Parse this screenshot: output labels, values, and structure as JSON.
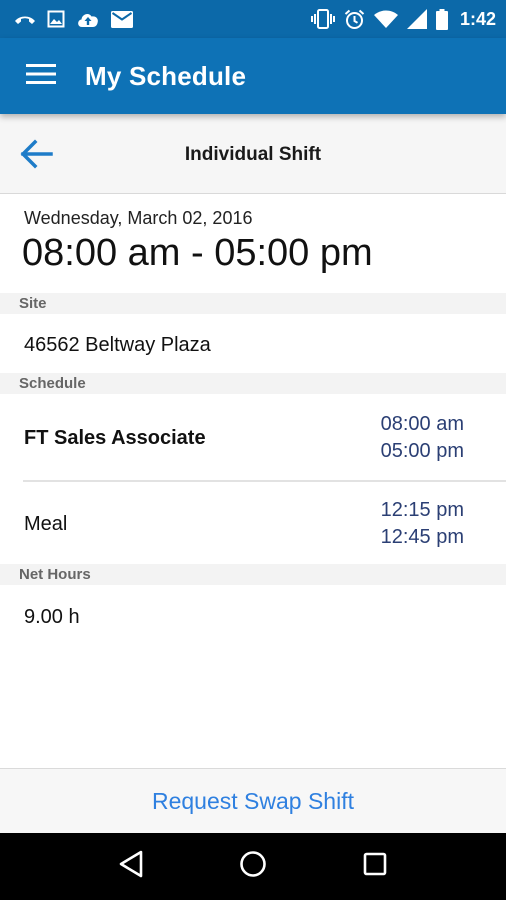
{
  "status_bar": {
    "time": "1:42",
    "left_icons": [
      "missed-call-icon",
      "image-icon",
      "cloud-upload-icon",
      "mail-icon"
    ],
    "right_icons": [
      "vibrate-icon",
      "alarm-icon",
      "wifi-icon",
      "signal-icon",
      "battery-icon"
    ]
  },
  "app_bar": {
    "title": "My Schedule",
    "menu_icon": "hamburger-menu-icon",
    "color": "#0e72b6"
  },
  "sub_header": {
    "title": "Individual Shift",
    "back_icon": "arrow-left-icon",
    "back_color": "#1e7cc8"
  },
  "shift": {
    "date": "Wednesday, March 02, 2016",
    "time_range": "08:00 am - 05:00 pm"
  },
  "site": {
    "header": "Site",
    "value": "46562 Beltway Plaza"
  },
  "schedule": {
    "header": "Schedule",
    "items": [
      {
        "label": "FT Sales Associate",
        "start": "08:00 am",
        "end": "05:00 pm"
      },
      {
        "label": "Meal",
        "start": "12:15 pm",
        "end": "12:45 pm"
      }
    ],
    "time_color": "#2b3f74"
  },
  "net_hours": {
    "header": "Net Hours",
    "value": "9.00 h"
  },
  "actions": {
    "swap_label": "Request Swap Shift",
    "swap_color": "#2f80e0"
  },
  "nav_bar": {
    "icons": [
      "nav-back-icon",
      "nav-home-icon",
      "nav-recents-icon"
    ]
  }
}
